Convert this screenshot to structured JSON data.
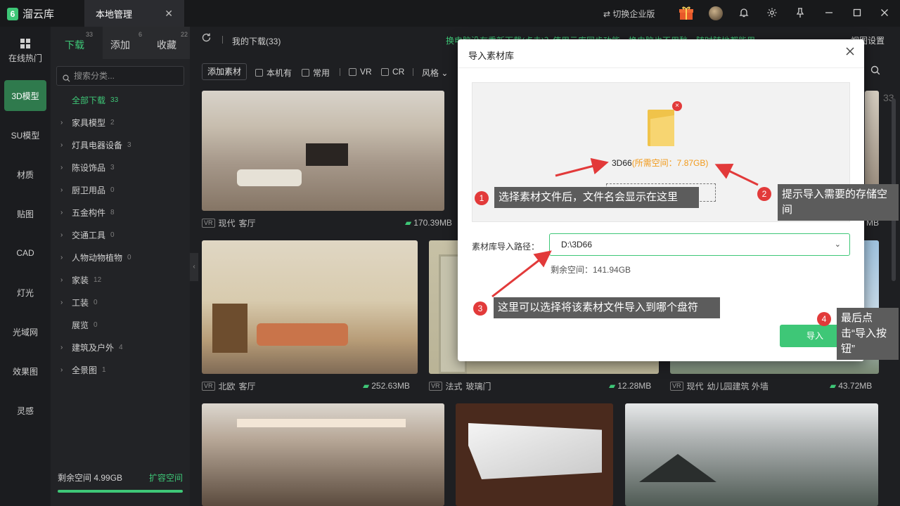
{
  "app": {
    "name": "溜云库",
    "logo_glyph": "6"
  },
  "titlebar": {
    "tab_label": "本地管理",
    "tab_close": "✕",
    "switch_enterprise": "⇄ 切换企业版"
  },
  "left_nav": [
    "在线热门",
    "3D模型",
    "SU模型",
    "材质",
    "贴图",
    "CAD",
    "灯光",
    "光域网",
    "效果图",
    "灵感"
  ],
  "category_panel": {
    "tabs": [
      {
        "label": "下载",
        "count": "33"
      },
      {
        "label": "添加",
        "count": "6"
      },
      {
        "label": "收藏",
        "count": "22"
      }
    ],
    "search_placeholder": "搜索分类...",
    "all": {
      "label": "全部下载",
      "count": "33"
    },
    "items": [
      {
        "label": "家具模型",
        "count": "2"
      },
      {
        "label": "灯具电器设备",
        "count": "3"
      },
      {
        "label": "陈设饰品",
        "count": "3"
      },
      {
        "label": "厨卫用品",
        "count": "0"
      },
      {
        "label": "五金构件",
        "count": "8"
      },
      {
        "label": "交通工具",
        "count": "0"
      },
      {
        "label": "人物动物植物",
        "count": "0"
      },
      {
        "label": "家装",
        "count": "12"
      },
      {
        "label": "工装",
        "count": "0"
      },
      {
        "label": "展览",
        "count": "0"
      },
      {
        "label": "建筑及户外",
        "count": "4"
      },
      {
        "label": "全景图",
        "count": "1"
      }
    ],
    "free_space": "剩余空间 4.99GB",
    "expand_space": "扩容空间"
  },
  "toolbar": {
    "breadcrumb": "我的下载(33)",
    "notice": "换电脑没有重新下载(点击)？使用云库同步功能，换电脑也不用愁，随时随地都能用",
    "view_settings": "视图设置",
    "add_asset": "添加素材",
    "filters": [
      "本机有",
      "常用",
      "VR",
      "CR"
    ],
    "style_label": "风格",
    "grid_count": "33"
  },
  "cards": [
    {
      "style": "现代",
      "tag": "客厅",
      "size": "170.39MB"
    },
    {
      "style": "北欧",
      "tag": "客厅",
      "size": "252.63MB"
    },
    {
      "style": "法式",
      "tag": "玻璃门",
      "size": "12.28MB"
    },
    {
      "style": "现代",
      "tag": "幼儿园建筑 外墙",
      "size": "43.72MB"
    }
  ],
  "card_right_partial_size": "MB",
  "modal": {
    "title": "导入素材库",
    "file_name": "3D66",
    "required_space": "(所需空间：7.87GB)",
    "drop_ghost": "D:\\3D66",
    "path_label": "素材库导入路径：",
    "path_value": "D:\\3D66",
    "remaining": "剩余空间：141.94GB",
    "import_button": "导入"
  },
  "annotations": [
    {
      "num": "1",
      "text": "选择素材文件后，文件名会显示在这里"
    },
    {
      "num": "2",
      "text": "提示导入需要的存储空间"
    },
    {
      "num": "3",
      "text": "这里可以选择将该素材文件导入到哪个盘符"
    },
    {
      "num": "4",
      "text": "最后点击“导入按钮”"
    }
  ],
  "colors": {
    "accent": "#3ec777",
    "annotation": "#e23a3a",
    "callout_bg": "#5c5c5c"
  }
}
